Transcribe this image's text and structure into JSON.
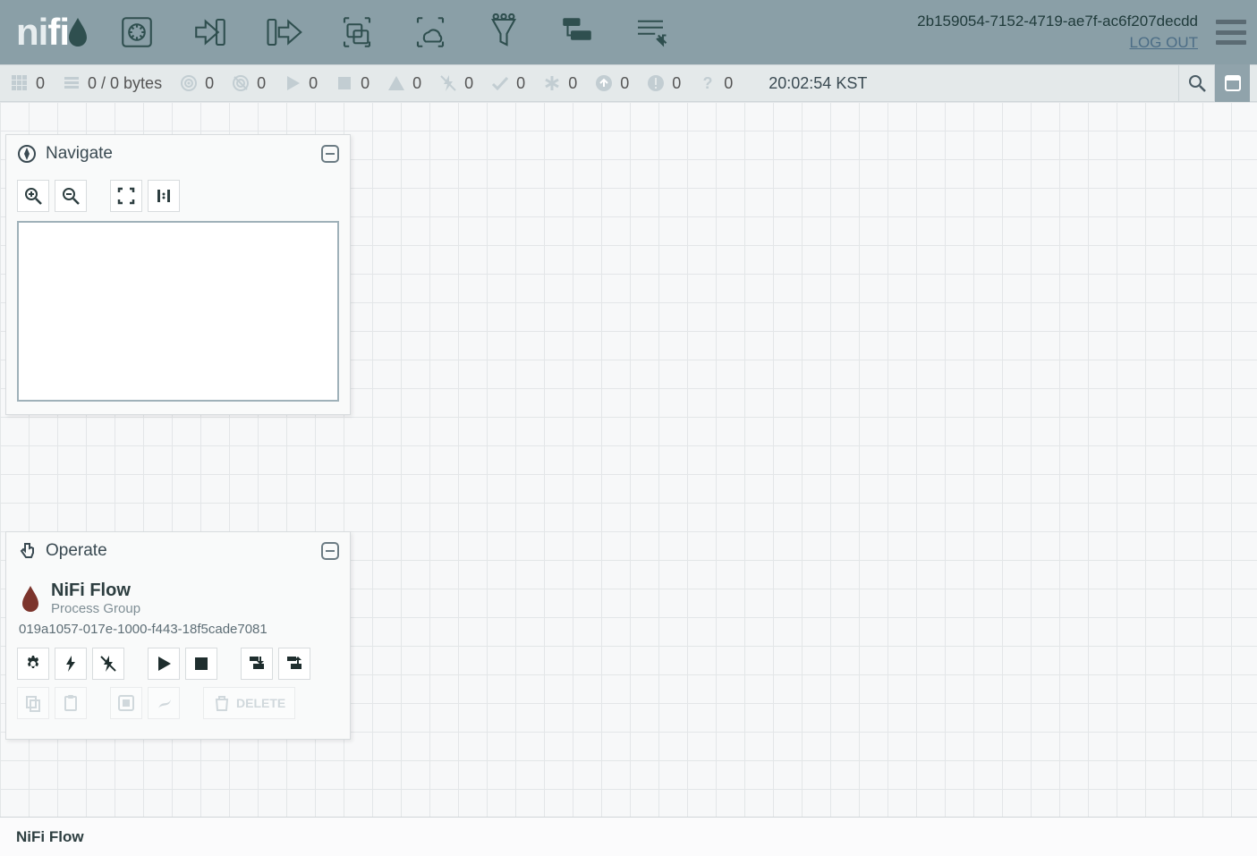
{
  "header": {
    "user_id": "2b159054-7152-4719-ae7f-ac6f207decdd",
    "logout_label": "LOG OUT"
  },
  "status": {
    "active_threads": "0",
    "queued": "0 / 0 bytes",
    "transmitting": "0",
    "not_transmitting": "0",
    "running": "0",
    "stopped": "0",
    "invalid": "0",
    "disabled": "0",
    "up_to_date": "0",
    "locally_modified": "0",
    "stale": "0",
    "sync_failure": "0",
    "unknown": "0",
    "last_refresh": "20:02:54 KST"
  },
  "panels": {
    "navigate_title": "Navigate",
    "operate_title": "Operate",
    "operate_flow_name": "NiFi Flow",
    "operate_flow_type": "Process Group",
    "operate_flow_id": "019a1057-017e-1000-f443-18f5cade7081",
    "delete_label": "DELETE"
  },
  "breadcrumb": "NiFi Flow"
}
